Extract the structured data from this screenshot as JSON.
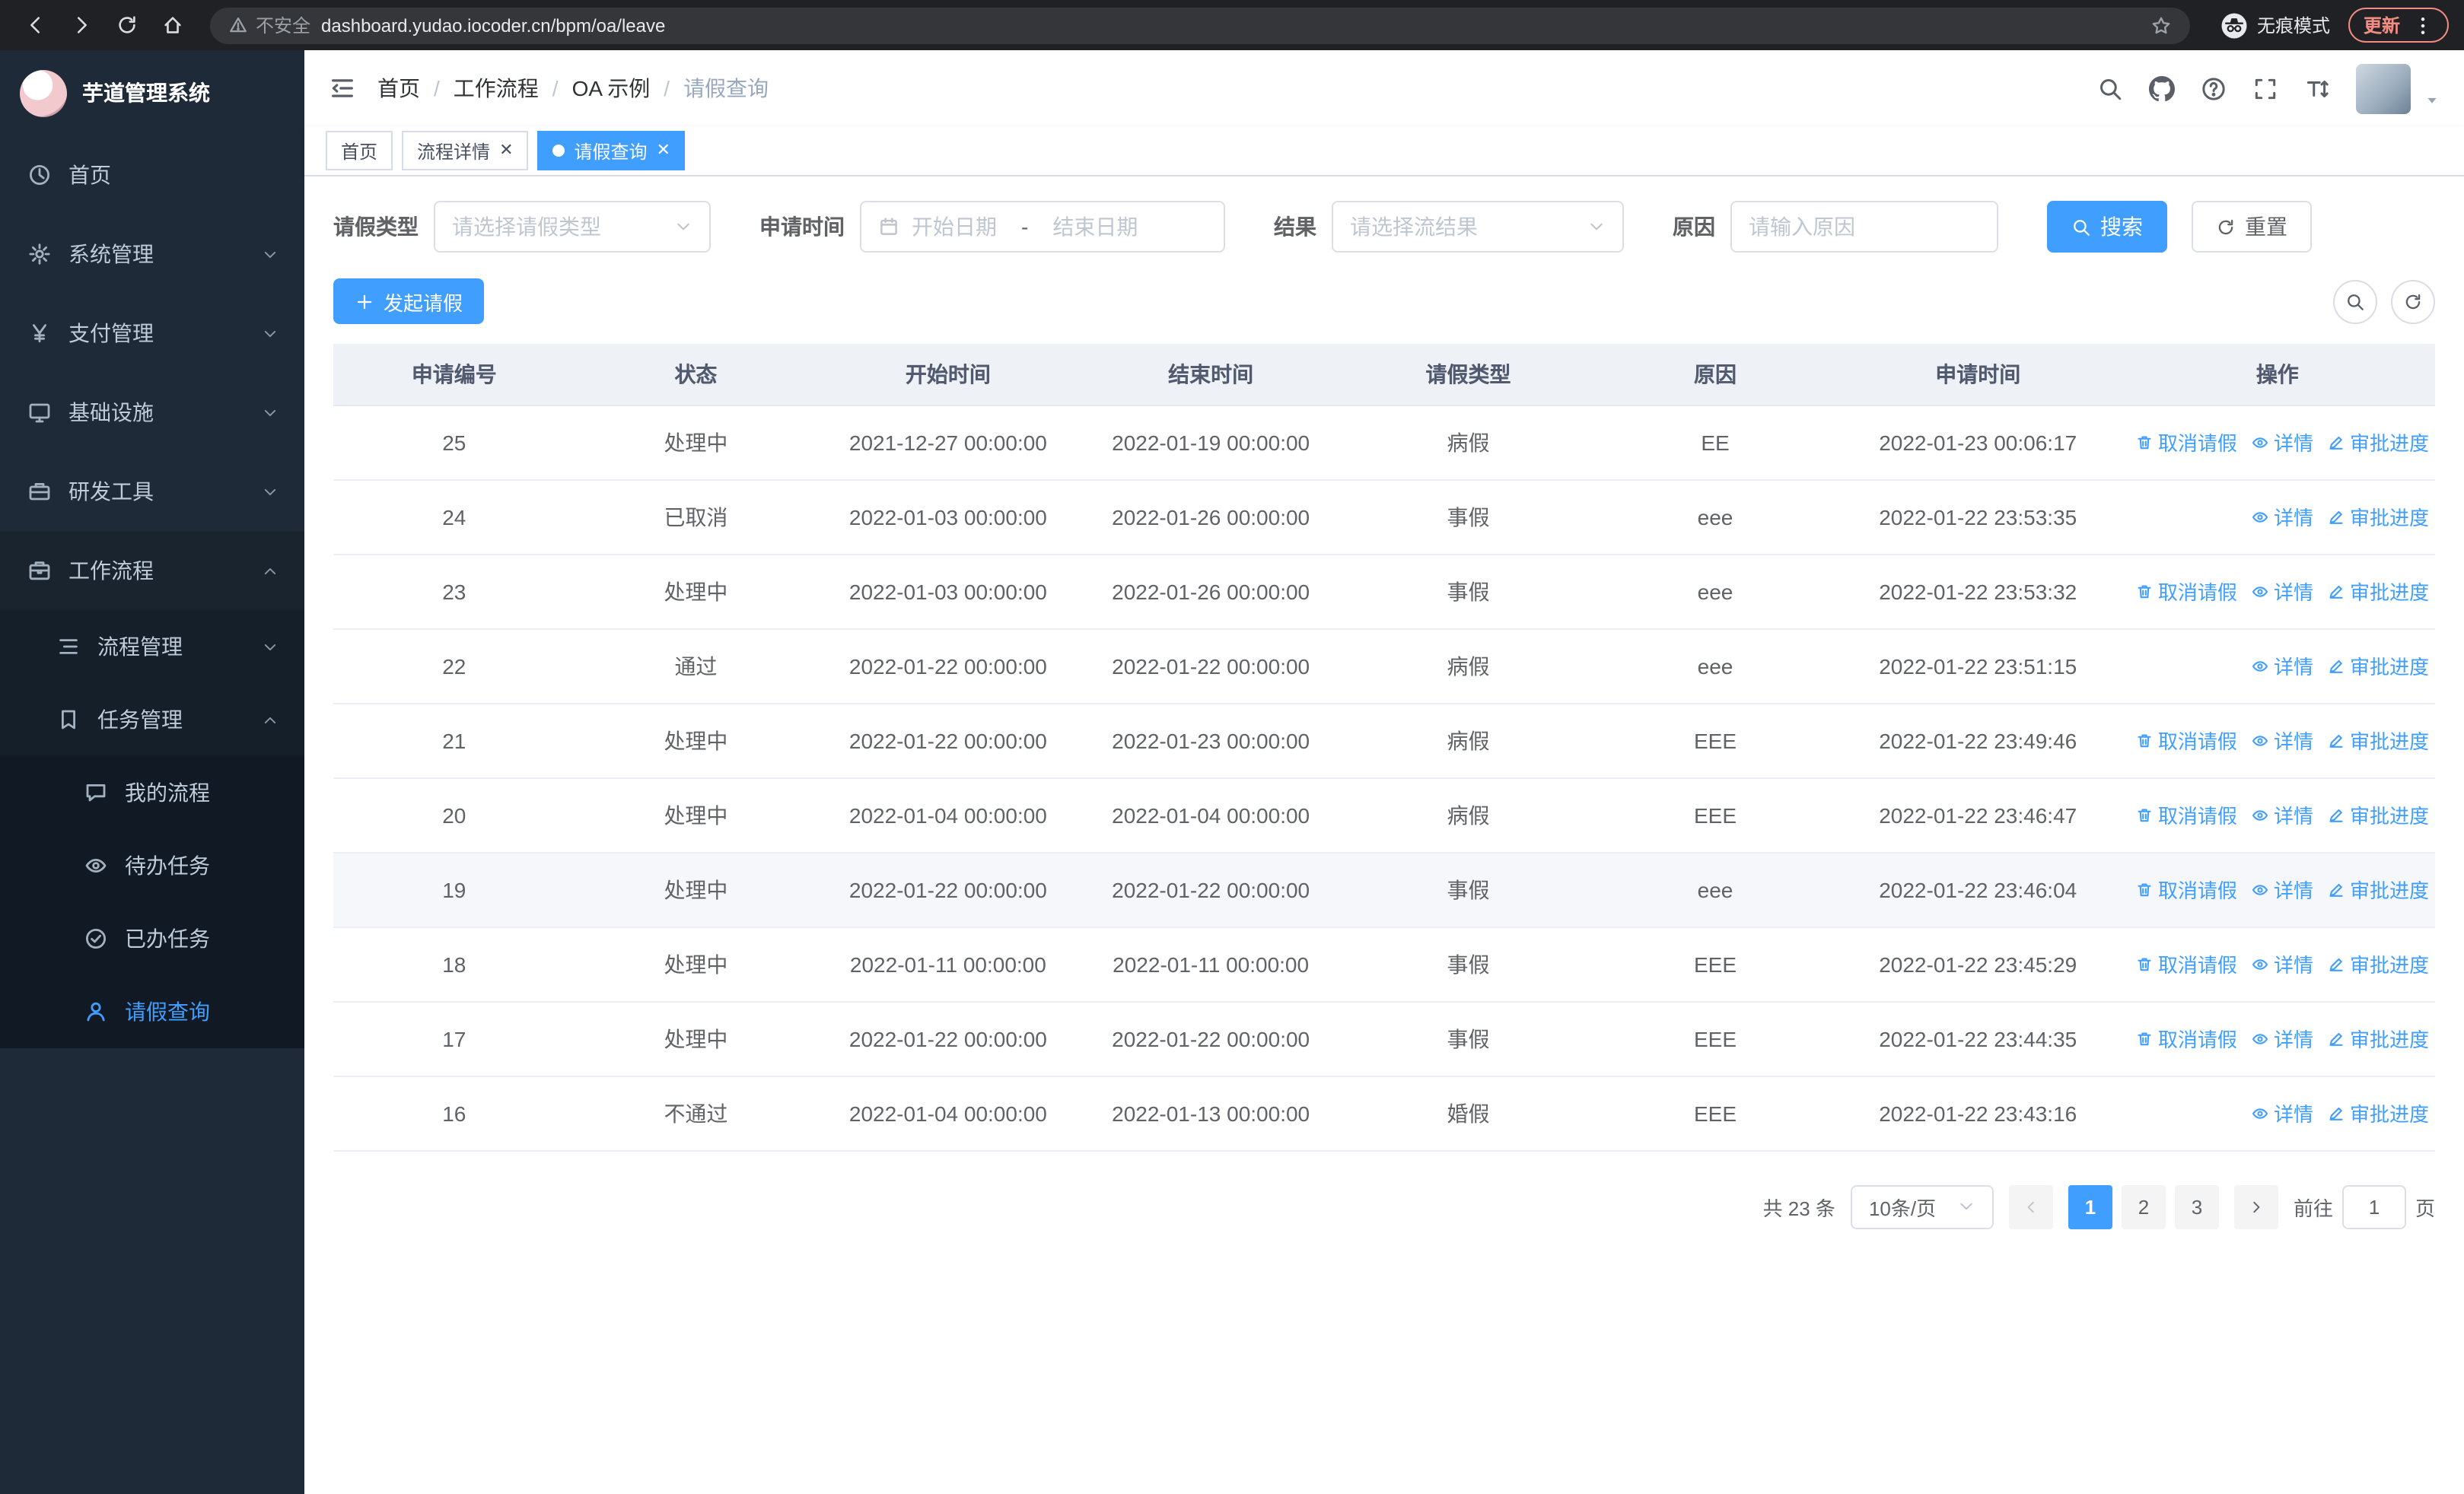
{
  "browser": {
    "security_warning": "不安全",
    "url": "dashboard.yudao.iocoder.cn/bpm/oa/leave",
    "incognito_label": "无痕模式",
    "update_label": "更新"
  },
  "colors": {
    "primary": "#409eff",
    "sidebar_bg": "#1e2a38",
    "chrome_bg": "#202124",
    "table_header_bg": "#eef1f6"
  },
  "sidebar": {
    "title": "芋道管理系统",
    "menu": [
      {
        "key": "home",
        "label": "首页",
        "icon": "dashboard",
        "level": 1
      },
      {
        "key": "system",
        "label": "系统管理",
        "icon": "gear",
        "level": 1,
        "arrow": "down"
      },
      {
        "key": "payment",
        "label": "支付管理",
        "icon": "yen",
        "level": 1,
        "arrow": "down"
      },
      {
        "key": "infra",
        "label": "基础设施",
        "icon": "monitor",
        "level": 1,
        "arrow": "down"
      },
      {
        "key": "devtools",
        "label": "研发工具",
        "icon": "toolbox",
        "level": 1,
        "arrow": "down"
      },
      {
        "key": "workflow",
        "label": "工作流程",
        "icon": "briefcase",
        "level": 1,
        "arrow": "up",
        "open": true
      },
      {
        "key": "process-mgmt",
        "label": "流程管理",
        "icon": "flow",
        "level": 2,
        "arrow": "down"
      },
      {
        "key": "task-mgmt",
        "label": "任务管理",
        "icon": "tasks",
        "level": 2,
        "arrow": "up"
      },
      {
        "key": "my-process",
        "label": "我的流程",
        "icon": "chat",
        "level": 3
      },
      {
        "key": "todo-tasks",
        "label": "待办任务",
        "icon": "eye",
        "level": 3
      },
      {
        "key": "done-tasks",
        "label": "已办任务",
        "icon": "done",
        "level": 3
      },
      {
        "key": "leave-query",
        "label": "请假查询",
        "icon": "user",
        "level": 3,
        "active": true
      }
    ]
  },
  "header": {
    "breadcrumb": [
      "首页",
      "工作流程",
      "OA 示例",
      "请假查询"
    ]
  },
  "tabs": [
    {
      "key": "home",
      "label": "首页"
    },
    {
      "key": "process-detail",
      "label": "流程详情",
      "closable": true
    },
    {
      "key": "leave-query",
      "label": "请假查询",
      "closable": true,
      "active": true
    }
  ],
  "filters": {
    "leave_type_label": "请假类型",
    "leave_type_placeholder": "请选择请假类型",
    "apply_time_label": "申请时间",
    "date_start_placeholder": "开始日期",
    "date_separator": "-",
    "date_end_placeholder": "结束日期",
    "result_label": "结果",
    "result_placeholder": "请选择流结果",
    "reason_label": "原因",
    "reason_placeholder": "请输入原因",
    "search_button": "搜索",
    "reset_button": "重置"
  },
  "toolbar": {
    "create_button": "发起请假"
  },
  "table": {
    "columns": [
      "申请编号",
      "状态",
      "开始时间",
      "结束时间",
      "请假类型",
      "原因",
      "申请时间",
      "操作"
    ],
    "action_labels": {
      "cancel": "取消请假",
      "detail": "详情",
      "progress": "审批进度"
    },
    "rows": [
      {
        "id": "25",
        "status": "处理中",
        "start": "2021-12-27 00:00:00",
        "end": "2022-01-19 00:00:00",
        "type": "病假",
        "reason": "EE",
        "applied": "2022-01-23 00:06:17",
        "actions": [
          "cancel",
          "detail",
          "progress"
        ]
      },
      {
        "id": "24",
        "status": "已取消",
        "start": "2022-01-03 00:00:00",
        "end": "2022-01-26 00:00:00",
        "type": "事假",
        "reason": "eee",
        "applied": "2022-01-22 23:53:35",
        "actions": [
          "detail",
          "progress"
        ]
      },
      {
        "id": "23",
        "status": "处理中",
        "start": "2022-01-03 00:00:00",
        "end": "2022-01-26 00:00:00",
        "type": "事假",
        "reason": "eee",
        "applied": "2022-01-22 23:53:32",
        "actions": [
          "cancel",
          "detail",
          "progress"
        ]
      },
      {
        "id": "22",
        "status": "通过",
        "start": "2022-01-22 00:00:00",
        "end": "2022-01-22 00:00:00",
        "type": "病假",
        "reason": "eee",
        "applied": "2022-01-22 23:51:15",
        "actions": [
          "detail",
          "progress"
        ]
      },
      {
        "id": "21",
        "status": "处理中",
        "start": "2022-01-22 00:00:00",
        "end": "2022-01-23 00:00:00",
        "type": "病假",
        "reason": "EEE",
        "applied": "2022-01-22 23:49:46",
        "actions": [
          "cancel",
          "detail",
          "progress"
        ]
      },
      {
        "id": "20",
        "status": "处理中",
        "start": "2022-01-04 00:00:00",
        "end": "2022-01-04 00:00:00",
        "type": "病假",
        "reason": "EEE",
        "applied": "2022-01-22 23:46:47",
        "actions": [
          "cancel",
          "detail",
          "progress"
        ]
      },
      {
        "id": "19",
        "status": "处理中",
        "start": "2022-01-22 00:00:00",
        "end": "2022-01-22 00:00:00",
        "type": "事假",
        "reason": "eee",
        "applied": "2022-01-22 23:46:04",
        "actions": [
          "cancel",
          "detail",
          "progress"
        ],
        "hover": true
      },
      {
        "id": "18",
        "status": "处理中",
        "start": "2022-01-11 00:00:00",
        "end": "2022-01-11 00:00:00",
        "type": "事假",
        "reason": "EEE",
        "applied": "2022-01-22 23:45:29",
        "actions": [
          "cancel",
          "detail",
          "progress"
        ]
      },
      {
        "id": "17",
        "status": "处理中",
        "start": "2022-01-22 00:00:00",
        "end": "2022-01-22 00:00:00",
        "type": "事假",
        "reason": "EEE",
        "applied": "2022-01-22 23:44:35",
        "actions": [
          "cancel",
          "detail",
          "progress"
        ]
      },
      {
        "id": "16",
        "status": "不通过",
        "start": "2022-01-04 00:00:00",
        "end": "2022-01-13 00:00:00",
        "type": "婚假",
        "reason": "EEE",
        "applied": "2022-01-22 23:43:16",
        "actions": [
          "detail",
          "progress"
        ]
      }
    ]
  },
  "pagination": {
    "total_text": "共 23 条",
    "page_size": "10条/页",
    "pages": [
      "1",
      "2",
      "3"
    ],
    "active_page": "1",
    "goto_prefix": "前往",
    "goto_value": "1",
    "goto_suffix": "页"
  }
}
